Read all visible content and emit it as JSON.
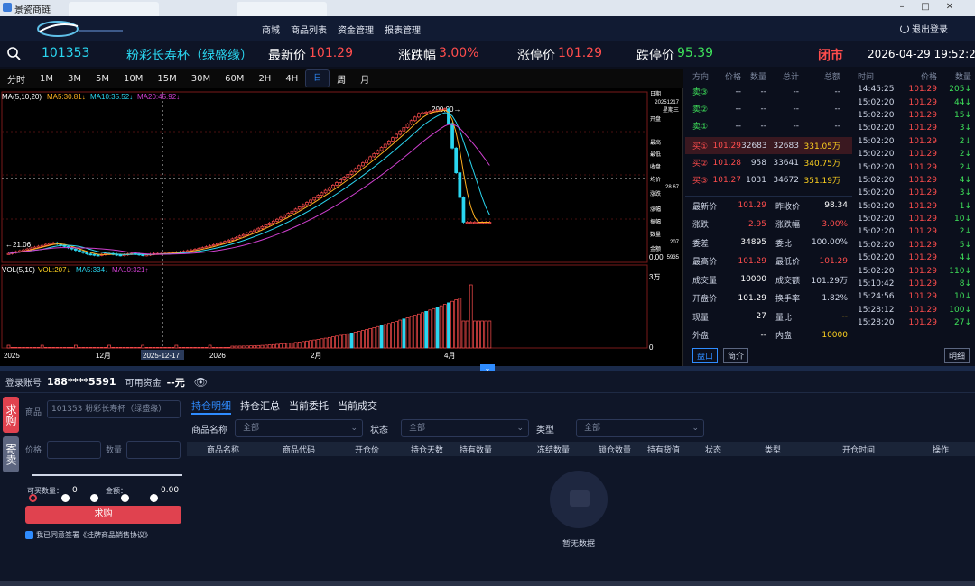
{
  "window": {
    "app_name": "景瓷商链",
    "tab1": "",
    "tab2": "",
    "controls": [
      "–",
      "□",
      "✕"
    ]
  },
  "nav": {
    "menu": [
      "商城",
      "商品列表",
      "资金管理",
      "报表管理"
    ],
    "logout": "退出登录"
  },
  "quote": {
    "code": "101353",
    "name": "粉彩长寿杯（绿盛缘）",
    "last_label": "最新价",
    "last_value": "101.29",
    "change_label": "涨跌幅",
    "change_value": "3.00%",
    "limit_up_label": "涨停价",
    "limit_up_value": "101.29",
    "limit_down_label": "跌停价",
    "limit_down_value": "95.39",
    "market_status": "闭市",
    "datetime": "2026-04-29 19:52:27"
  },
  "periods": {
    "items": [
      "分时",
      "1M",
      "3M",
      "5M",
      "10M",
      "15M",
      "30M",
      "60M",
      "2H",
      "4H",
      "日",
      "周",
      "月"
    ],
    "selected": "日"
  },
  "chart": {
    "ma_label": "MA(5,10,20)",
    "ma5": "MA5:30.81↓",
    "ma10": "MA10:35.52↓",
    "ma20": "MA20:45.92↓",
    "vol_label": "VOL(5,10)",
    "vol": "VOL:207↓",
    "vma5": "MA5:334↓",
    "vma10": "MA10:321↑",
    "high_mark": "200.00→",
    "low_mark": "←21.06",
    "vol_axis_top": "3万",
    "vol_axis_zero": "0",
    "price_axis_zero": "0.00",
    "x_labels": [
      "2025",
      "12月",
      "2025-12-17",
      "2026",
      "2月",
      "4月"
    ],
    "info_panel": {
      "date_label": "日期",
      "date": "20251217",
      "weekday": "星期三",
      "open_label": "开盘",
      "high_label": "最高",
      "low_label": "最低",
      "close_label": "收盘",
      "avg_label": "均价",
      "avg": "28.67",
      "chg_label": "涨跌",
      "pct_label": "涨幅",
      "amp_label": "振幅",
      "vol_label": "数量",
      "vol": "207",
      "amt_label": "金额",
      "amt": "5935"
    }
  },
  "orderbook": {
    "headers": [
      "方向",
      "价格",
      "数量",
      "总计",
      "总额"
    ],
    "asks": [
      {
        "side": "卖③",
        "price": "--",
        "qty": "--",
        "total": "--",
        "amount": "--"
      },
      {
        "side": "卖②",
        "price": "--",
        "qty": "--",
        "total": "--",
        "amount": "--"
      },
      {
        "side": "卖①",
        "price": "--",
        "qty": "--",
        "total": "--",
        "amount": "--"
      }
    ],
    "bids": [
      {
        "side": "买①",
        "price": "101.29",
        "qty": "32683",
        "total": "32683",
        "amount": "331.05万"
      },
      {
        "side": "买②",
        "price": "101.28",
        "qty": "958",
        "total": "33641",
        "amount": "340.75万"
      },
      {
        "side": "买③",
        "price": "101.27",
        "qty": "1031",
        "total": "34672",
        "amount": "351.19万"
      }
    ],
    "stats": [
      {
        "l1": "最新价",
        "v1": "101.29",
        "l2": "昨收价",
        "v2": "98.34"
      },
      {
        "l1": "涨跌",
        "v1": "2.95",
        "l2": "涨跌幅",
        "v2": "3.00%"
      },
      {
        "l1": "委差",
        "v1": "34895",
        "l2": "委比",
        "v2": "100.00%"
      },
      {
        "l1": "最高价",
        "v1": "101.29",
        "l2": "最低价",
        "v2": "101.29"
      },
      {
        "l1": "成交量",
        "v1": "10000",
        "l2": "成交额",
        "v2": "101.29万"
      },
      {
        "l1": "开盘价",
        "v1": "101.29",
        "l2": "换手率",
        "v2": "1.82%"
      },
      {
        "l1": "现量",
        "v1": "27",
        "l2": "量比",
        "v2": "--"
      },
      {
        "l1": "外盘",
        "v1": "--",
        "l2": "内盘",
        "v2": "10000"
      }
    ],
    "btn_panel": "盘口",
    "btn_brief": "简介"
  },
  "ticks": {
    "headers": [
      "时间",
      "价格",
      "数量"
    ],
    "rows": [
      {
        "t": "14:45:25",
        "p": "101.29",
        "q": "205"
      },
      {
        "t": "15:02:20",
        "p": "101.29",
        "q": "44"
      },
      {
        "t": "15:02:20",
        "p": "101.29",
        "q": "15"
      },
      {
        "t": "15:02:20",
        "p": "101.29",
        "q": "3"
      },
      {
        "t": "15:02:20",
        "p": "101.29",
        "q": "2"
      },
      {
        "t": "15:02:20",
        "p": "101.29",
        "q": "2"
      },
      {
        "t": "15:02:20",
        "p": "101.29",
        "q": "2"
      },
      {
        "t": "15:02:20",
        "p": "101.29",
        "q": "4"
      },
      {
        "t": "15:02:20",
        "p": "101.29",
        "q": "3"
      },
      {
        "t": "15:02:20",
        "p": "101.29",
        "q": "1"
      },
      {
        "t": "15:02:20",
        "p": "101.29",
        "q": "10"
      },
      {
        "t": "15:02:20",
        "p": "101.29",
        "q": "2"
      },
      {
        "t": "15:02:20",
        "p": "101.29",
        "q": "5"
      },
      {
        "t": "15:02:20",
        "p": "101.29",
        "q": "4"
      },
      {
        "t": "15:02:20",
        "p": "101.29",
        "q": "110"
      },
      {
        "t": "15:10:42",
        "p": "101.29",
        "q": "8"
      },
      {
        "t": "15:24:56",
        "p": "101.29",
        "q": "10"
      },
      {
        "t": "15:28:12",
        "p": "101.29",
        "q": "100"
      },
      {
        "t": "15:28:20",
        "p": "101.29",
        "q": "27"
      }
    ],
    "btn_detail": "明细"
  },
  "account": {
    "login_label": "登录账号",
    "login_value": "188****5591",
    "fund_label": "可用资金",
    "fund_value": "--元"
  },
  "orderform": {
    "tab_buy": "求购",
    "tab_sell": "寄卖",
    "product_label": "商品",
    "product_value": "101353 粉彩长寿杯（绿盛缘）",
    "price_label": "价格",
    "qty_label": "数量",
    "buyable_label": "可买数量：",
    "buyable_value": "0",
    "amount_label": "金额：",
    "amount_value": "0.00",
    "submit": "求购",
    "agree": "我已同意签署《挂牌商品销售协议》"
  },
  "positions": {
    "tabs": [
      "持仓明细",
      "持仓汇总",
      "当前委托",
      "当前成交"
    ],
    "filter_name_label": "商品名称",
    "filter_status_label": "状态",
    "filter_type_label": "类型",
    "filter_all": "全部",
    "columns": [
      "商品名称",
      "商品代码",
      "开仓价",
      "持仓天数",
      "持有数量",
      "冻结数量",
      "锁仓数量",
      "持有货值",
      "状态",
      "类型",
      "开仓时间",
      "操作"
    ],
    "empty_text": "暂无数据"
  },
  "colors": {
    "up": "#ff4d4d",
    "down": "#3ee05a",
    "accent": "#2f8cff",
    "bg": "#0b0f1c"
  }
}
